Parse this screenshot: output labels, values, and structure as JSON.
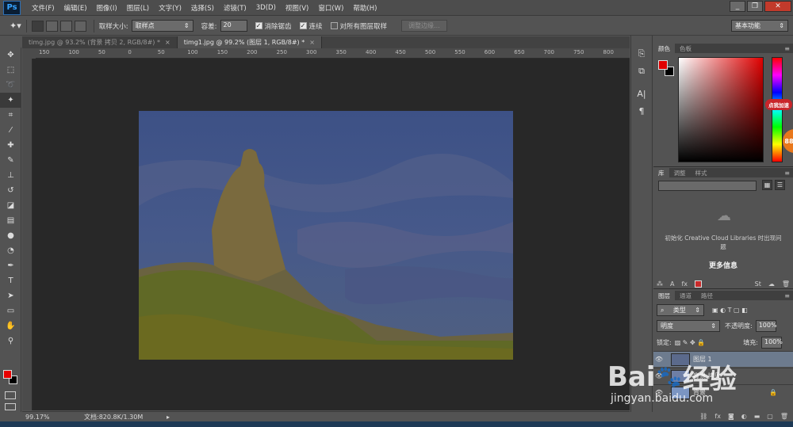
{
  "app": {
    "logo": "Ps",
    "menu": [
      "文件(F)",
      "编辑(E)",
      "图像(I)",
      "图层(L)",
      "文字(Y)",
      "选择(S)",
      "滤镜(T)",
      "3D(D)",
      "视图(V)",
      "窗口(W)",
      "帮助(H)"
    ],
    "window_controls": [
      "minimize",
      "restore",
      "close"
    ]
  },
  "options": {
    "sample_size_label": "取样大小:",
    "sample_size_value": "取样点",
    "tolerance_label": "容差:",
    "tolerance_value": "20",
    "antialias_label": "消除锯齿",
    "antialias_checked": true,
    "contiguous_label": "连续",
    "contiguous_checked": true,
    "all_layers_label": "对所有图层取样",
    "all_layers_checked": false,
    "refine_edge_label": "调整边缘...",
    "workspace": "基本功能"
  },
  "tabs": [
    {
      "label": "timg.jpg @ 93.2% (背景 拷贝 2, RGB/8#) *",
      "active": false
    },
    {
      "label": "timg1.jpg @ 99.2% (图层 1, RGB/8#) *",
      "active": true
    }
  ],
  "ruler": {
    "h_labels": [
      "150",
      "100",
      "50",
      "0",
      "50",
      "100",
      "150",
      "200",
      "250",
      "300",
      "350",
      "400",
      "450",
      "500",
      "550",
      "600",
      "650",
      "700",
      "750",
      "800"
    ]
  },
  "status": {
    "zoom": "99.17%",
    "doc_size": "文档:820.8K/1.30M"
  },
  "color_panel": {
    "tabs": [
      "颜色",
      "色板"
    ],
    "fg": "#e80000",
    "bg": "#000000",
    "badge": "点我加速",
    "badge_num": "88"
  },
  "library_panel": {
    "tabs": [
      "库",
      "调整",
      "样式"
    ],
    "empty_text": "初始化 Creative Cloud Libraries 时出现问题",
    "more_info": "更多信息"
  },
  "layers_panel": {
    "tabs": [
      "图层",
      "通道",
      "路径"
    ],
    "filter_label": "类型",
    "blend_mode": "明度",
    "opacity_label": "不透明度:",
    "opacity_value": "100%",
    "lock_label": "锁定:",
    "fill_label": "填充:",
    "fill_value": "100%",
    "layers": [
      {
        "name": "图层 1",
        "selected": true
      },
      {
        "name": "背景 拷贝",
        "selected": false
      },
      {
        "name": "背景",
        "selected": false,
        "locked": true
      }
    ]
  },
  "watermark": {
    "brand_left": "Bai",
    "brand_right": "经验",
    "url": "jingyan.baidu.com"
  },
  "icons": {
    "tools": [
      "move-icon",
      "marquee-icon",
      "lasso-icon",
      "magic-wand-icon",
      "crop-icon",
      "eyedropper-icon",
      "healing-brush-icon",
      "brush-icon",
      "clone-stamp-icon",
      "history-brush-icon",
      "eraser-icon",
      "gradient-icon",
      "blur-icon",
      "dodge-icon",
      "pen-icon",
      "type-icon",
      "path-select-icon",
      "rectangle-icon",
      "hand-icon",
      "zoom-icon"
    ]
  }
}
